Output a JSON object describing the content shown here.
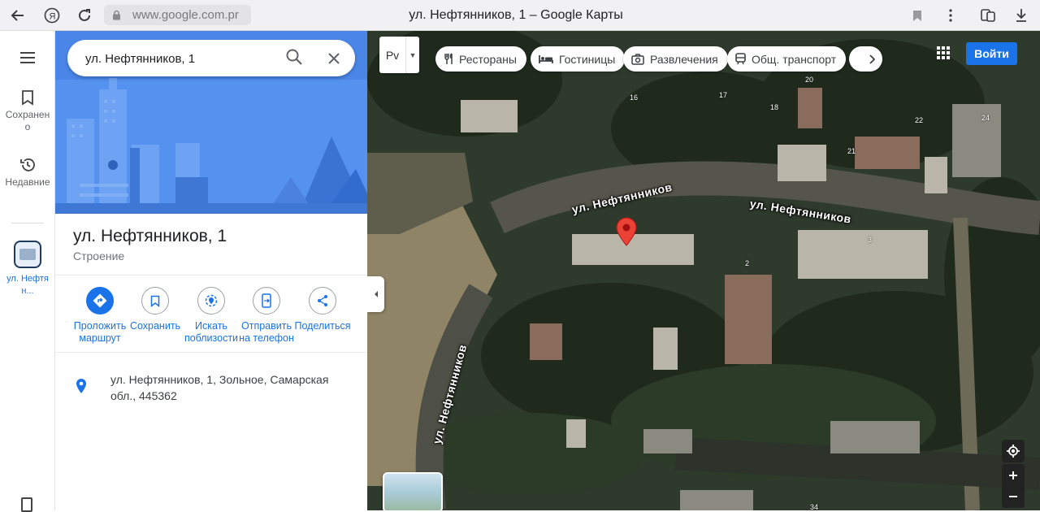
{
  "browser": {
    "url": "www.google.com.pr",
    "title": "ул. Нефтянников, 1 – Google Карты"
  },
  "rail": {
    "saved": "Сохранено",
    "recent": "Недавние",
    "current_item": "ул. Нефтян..."
  },
  "search": {
    "value": "ул. Нефтянников, 1"
  },
  "place": {
    "title": "ул. Нефтянников, 1",
    "type": "Строение",
    "address": "ул. Нефтянников, 1, Зольное, Самарская обл., 445362"
  },
  "actions": [
    {
      "label": "Проложить\nмаршрут",
      "icon": "directions-icon"
    },
    {
      "label": "Сохранить",
      "icon": "bookmark-icon"
    },
    {
      "label": "Искать\nпоблизости",
      "icon": "nearby-icon"
    },
    {
      "label": "Отправить\nна телефон",
      "icon": "send-to-phone-icon"
    },
    {
      "label": "Поделиться",
      "icon": "share-icon"
    }
  ],
  "map": {
    "layer_label": "Рv",
    "chips": [
      {
        "label": "Рестораны",
        "icon": "restaurant-icon"
      },
      {
        "label": "Гостиницы",
        "icon": "hotel-icon"
      },
      {
        "label": "Развлечения",
        "icon": "camera-icon"
      },
      {
        "label": "Общ. транспорт",
        "icon": "transit-icon"
      }
    ],
    "signin": "Войти",
    "streets": {
      "s1": "ул. Нефтянников",
      "s2": "ул. Нефтянников",
      "s3": "ул. Нефтянников"
    },
    "house_numbers": {
      "h16": "16",
      "h17": "17",
      "h18": "18",
      "h20": "20",
      "h21": "21",
      "h22": "22",
      "h24": "24",
      "h3": "3",
      "h2": "2",
      "h34": "34"
    },
    "accent_color": "#1a73e8",
    "pin_color": "#ea4335"
  }
}
